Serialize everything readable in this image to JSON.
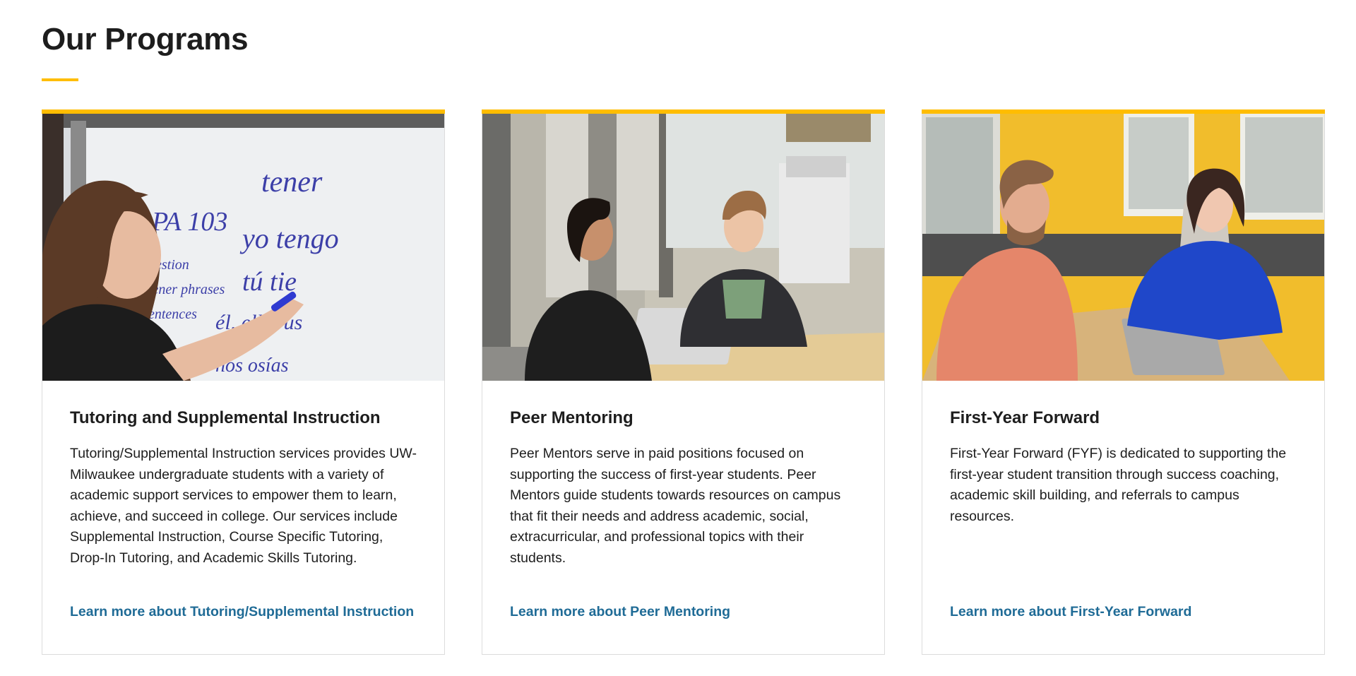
{
  "section": {
    "title": "Our Programs",
    "accent_color": "#ffbd00",
    "link_color": "#1f6b96"
  },
  "cards": [
    {
      "title": "Tutoring and Supplemental Instruction",
      "text": "Tutoring/Supplemental Instruction services provides UW-Milwaukee undergraduate students with a variety of academic support services to empower them to learn, achieve, and succeed in college. Our services include Supplemental Instruction, Course Specific Tutoring, Drop-In Tutoring, and Academic Skills Tutoring.",
      "link": "Learn more about Tutoring/Supplemental Instruction",
      "image": "photo-student-writing-spanish-on-whiteboard",
      "whiteboard": {
        "course": "PA 103",
        "line1": "tener",
        "line2": "yo tengo",
        "line3": "tú tie",
        "line4": "él, ella, us",
        "line5": "nos   osías",
        "note1": "uestion",
        "note2": "tener phrases",
        "note3": "entences"
      }
    },
    {
      "title": "Peer Mentoring",
      "text": "Peer Mentors serve in paid positions focused on supporting the success of first-year students. Peer Mentors guide students towards resources on campus that fit their needs and address academic, social, extracurricular, and professional topics with their students.",
      "link": "Learn more about Peer Mentoring",
      "image": "photo-two-students-at-laptop-in-office"
    },
    {
      "title": "First-Year Forward",
      "text": "First-Year Forward (FYF) is dedicated to supporting the first-year student transition through success coaching, academic skill building, and referrals to campus resources.",
      "link": "Learn more about First-Year Forward",
      "image": "photo-coach-and-student-at-table-yellow-room"
    }
  ]
}
